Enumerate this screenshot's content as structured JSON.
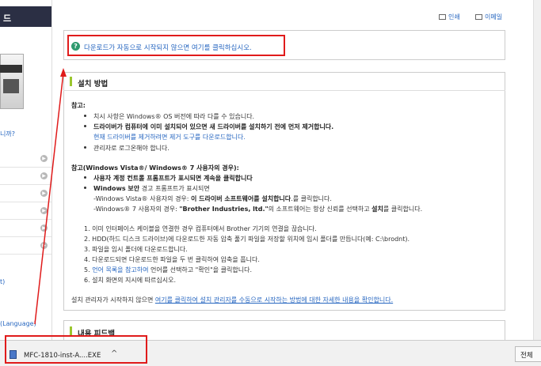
{
  "sidebar": {
    "header": "드",
    "link": "니까?",
    "lang_link": "t)",
    "lang_link2": "(Language)"
  },
  "top": {
    "print": "인쇄",
    "email": "이메일"
  },
  "download": {
    "prompt": "다운로드가 자동으로 시작되지 않으면 여기를 클릭하십시오."
  },
  "install": {
    "title": "설치 방법",
    "note_label": "참고:",
    "bullets1": [
      "치시 사항은 Windows® OS 버전에 따라 다를 수 있습니다.",
      "드라이버가 컴퓨터에 이미 설치되어 있으면 새 드라이버를 설치하기 전에 먼저 제거합니다.",
      "관리자로 로그온해야 합니다."
    ],
    "remove_link": "현재 드라이버를 제거하려면 제거 도구를 다운로드합니다.",
    "vista_label": "참고(Windows Vista®/ Windows® 7 사용자의 경우):",
    "vista_b1": "사용자 계정 컨트롤 프롬프트가 표시되면 계속을 클릭합니다",
    "vista_b2_bold": "Windows 보안",
    "vista_b2_rest": " 경고 프롬프트가 표시되면",
    "vista_line1_a": "-Windows Vista® 사용자의 경우: ",
    "vista_line1_b": "이 드라이버 소프트웨어를 설치합니다",
    "vista_line1_c": ".를 클릭합니다.",
    "vista_line2_a": "-Windows® 7 사용자의 경우: ",
    "vista_line2_b": "\"Brother Industries, ltd.\"",
    "vista_line2_c": "의 소프트웨어는 항상 신뢰를 선택하고 ",
    "vista_line2_d": "설치",
    "vista_line2_e": "를 클릭합니다.",
    "steps": [
      "1. 이미 인터페이스 케이블을 연결한 경우 컴퓨터에서 Brother 기기의 연결을 끊습니다.",
      "2. HDD(하드 디스크 드라이브)에 다운로드한 자동 압축 풀기 파일을 저장할 위치에 임시 폴더를 만듭니다(예: C:\\brodnt).",
      "3. 파일을 임시 폴더에 다운로드합니다.",
      "4. 다운로드되면 다운로드한 파일을 두 번 클릭하여 압축을 풉니다.",
      "6. 설치 화면의 지시에 따르십시오."
    ],
    "step5_num": "5. ",
    "step5_link": "언어 목록을 참고하여",
    "step5_rest": " 언어를 선택하고 \"확인\"을 클릭합니다.",
    "footer_text": "설치 관리자가 시작하지 않으면 ",
    "footer_link": "여기를 클릭하여 설치 관리자를 수동으로 시작하는 방법에 대한 자세한 내용을 확인합니다."
  },
  "feedback": {
    "title": "내용 피드백"
  },
  "download_bar": {
    "file_name": "MFC-1810-inst-A....EXE",
    "caret": "^",
    "show_all": "전체"
  },
  "colors": {
    "accent_link": "#2666c0",
    "highlight_red": "#e01b1b",
    "section_green": "#9bc62f"
  }
}
